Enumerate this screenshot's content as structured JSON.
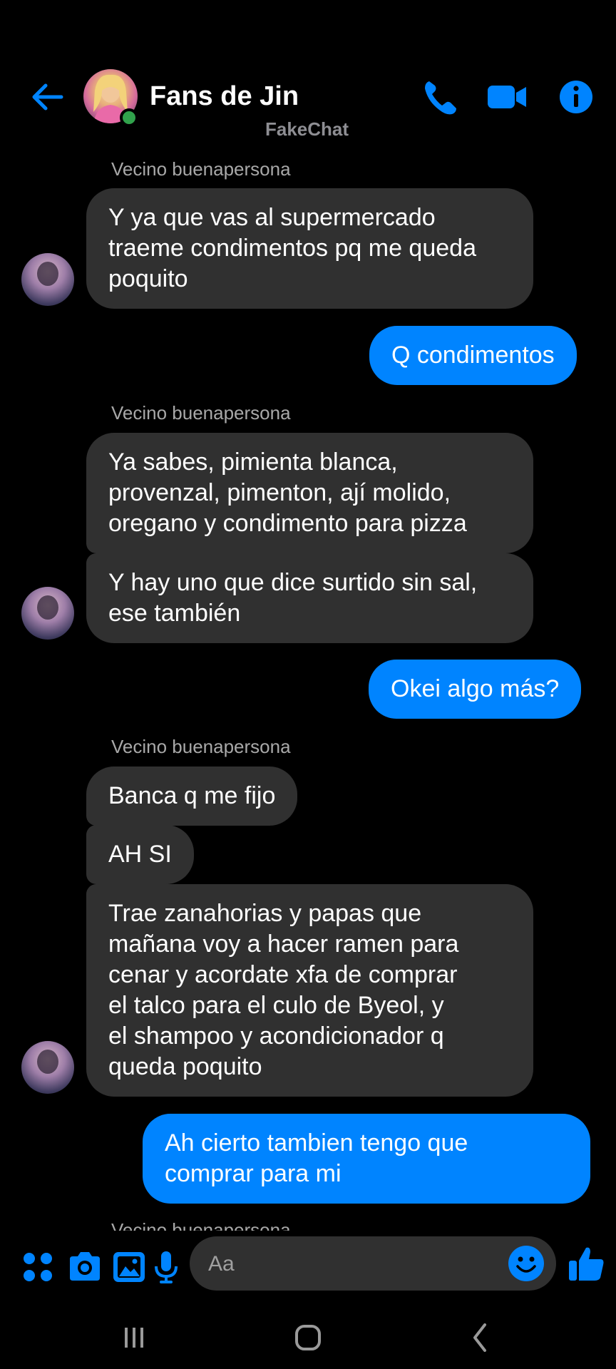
{
  "header": {
    "title": "Fans de Jin",
    "watermark": "FakeChat",
    "icons": [
      "back-arrow-icon",
      "phone-icon",
      "video-camera-icon",
      "info-icon"
    ]
  },
  "colors": {
    "accent": "#0084ff",
    "received_bubble": "#303030",
    "background": "#000000",
    "online": "#31a24c"
  },
  "messages": [
    {
      "type": "sender",
      "text": "Vecino buenapersona"
    },
    {
      "type": "received",
      "text": "Y ya que vas al supermercado\ntraeme condimentos pq me queda\npoquito"
    },
    {
      "type": "sent",
      "text": "Q condimentos"
    },
    {
      "type": "sender",
      "text": "Vecino buenapersona"
    },
    {
      "type": "received",
      "text": "Ya sabes, pimienta blanca,\nprovenzal, pimenton, ají molido,\noregano y condimento para pizza"
    },
    {
      "type": "received",
      "text": "Y hay uno que dice surtido sin sal,\nese también"
    },
    {
      "type": "sent",
      "text": "Okei algo más?"
    },
    {
      "type": "sender",
      "text": "Vecino buenapersona"
    },
    {
      "type": "received",
      "text": "Banca q me fijo"
    },
    {
      "type": "received",
      "text": "AH SI"
    },
    {
      "type": "received",
      "text": "Trae zanahorias y papas que\nmañana voy a hacer ramen para\ncenar y acordate xfa de comprar\nel talco para el culo de Byeol, y\nel shampoo y acondicionador q\nqueda poquito"
    },
    {
      "type": "sent",
      "text": "Ah cierto tambien tengo que\ncomprar para mi"
    },
    {
      "type": "sender",
      "text": "Vecino buenapersona"
    }
  ],
  "composer": {
    "placeholder": "Aa",
    "icons": [
      "apps-grid-icon",
      "camera-icon",
      "gallery-icon",
      "microphone-icon",
      "emoji-icon",
      "thumbs-up-icon"
    ]
  },
  "navbar": {
    "icons": [
      "recent-apps-icon",
      "home-icon",
      "back-icon"
    ]
  }
}
